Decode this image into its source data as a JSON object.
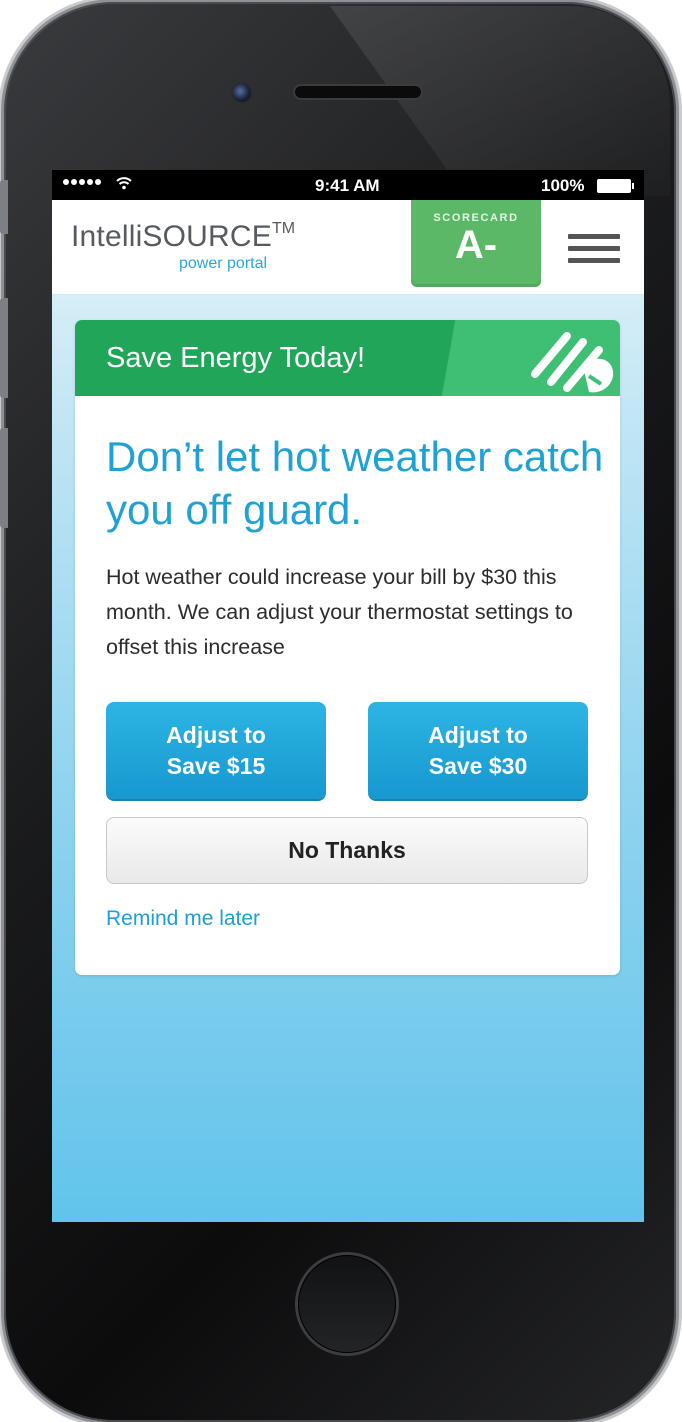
{
  "status_bar": {
    "time": "9:41 AM",
    "battery": "100%",
    "signal_icon": "signal-dots-icon",
    "wifi_icon": "wifi-icon",
    "battery_icon": "battery-full-icon"
  },
  "header": {
    "logo_main": "IntelliSOURCE",
    "logo_tm": "TM",
    "logo_sub": "power portal",
    "scorecard_label": "SCORECARD",
    "scorecard_grade": "A-",
    "menu_icon": "hamburger-menu-icon"
  },
  "card": {
    "banner_title": "Save Energy Today!",
    "banner_icon": "lightbulb-icon",
    "headline": "Don’t let hot weather catch you off guard.",
    "body": "Hot weather could increase your bill by $30 this month. We can adjust your thermostat settings to offset this increase",
    "actions": {
      "save_15_line1": "Adjust to",
      "save_15_line2": "Save $15",
      "save_30_line1": "Adjust to",
      "save_30_line2": "Save $30",
      "no_thanks": "No Thanks",
      "remind_later": "Remind me later"
    }
  },
  "colors": {
    "brand_green": "#21a659",
    "scorecard_green": "#5ab866",
    "brand_blue": "#20a1d3",
    "button_blue": "#1da6dc"
  }
}
